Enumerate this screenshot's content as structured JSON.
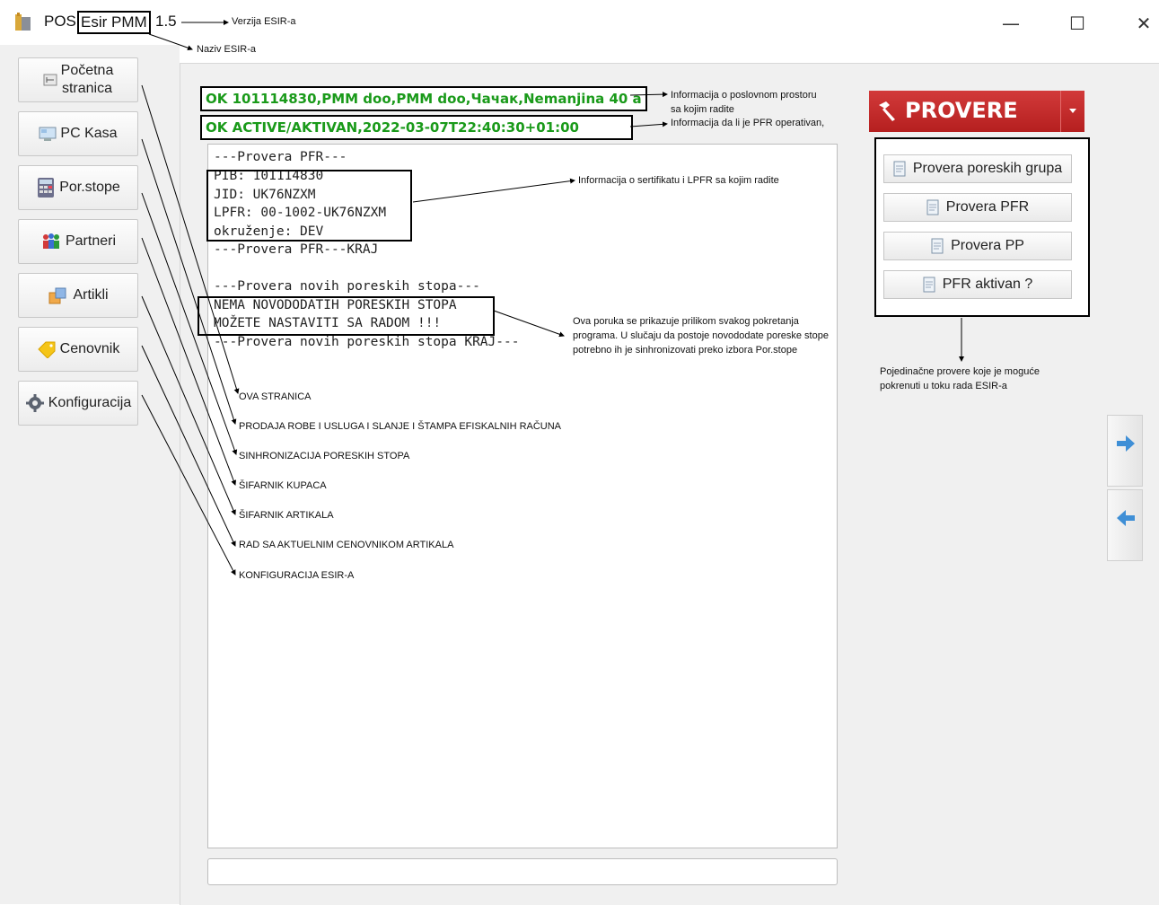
{
  "window": {
    "title_prefix": "POS",
    "app_name": "Esir PMM",
    "version": "1.5",
    "minimize": "—",
    "maximize": "☐",
    "close": "✕"
  },
  "nav": {
    "home_line1": "Početna",
    "home_line2": "stranica",
    "pc_kasa": "PC Kasa",
    "por_stope": "Por.stope",
    "partneri": "Partneri",
    "artikli": "Artikli",
    "cenovnik": "Cenovnik",
    "konfiguracija": "Konfiguracija"
  },
  "status": {
    "business_info": "OK 101114830,PMM doo,PMM doo,Чачак,Nemanjina 40 a",
    "pfr_status": "OK ACTIVE/AKTIVAN,2022-03-07T22:40:30+01:00"
  },
  "log": {
    "lines": [
      "---Provera PFR---",
      "PIB: 101114830",
      "JID: UK76NZXM",
      "LPFR: 00-1002-UK76NZXM",
      "okruženje: DEV",
      "---Provera PFR---KRAJ",
      "",
      "---Provera novih poreskih stopa---",
      "NEMA NOVODODATIH PORESKIH STOPA",
      "MOŽETE NASTAVITI SA RADOM !!!",
      "---Provera novih poreskih stopa KRAJ---"
    ]
  },
  "provere": {
    "title": "PROVERE",
    "buttons": [
      "Provera poreskih grupa",
      "Provera PFR",
      "Provera PP",
      "PFR aktivan ?"
    ]
  },
  "annotations": {
    "verzija": "Verzija ESIR-a",
    "naziv": "Naziv ESIR-a",
    "poslovni_prostor_1": "Informacija o poslovnom prostoru",
    "poslovni_prostor_2": "sa kojim radite",
    "pfr_operativan": "Informacija da li je PFR operativan,",
    "sertifikat": "Informacija o sertifikatu i LPFR sa kojim radite",
    "poruka": "Ova poruka se prikazuje prilikom svakog pokretanja programa. U slučaju da postoje novododate poreske stope potrebno ih je sinhronizovati preko izbora Por.stope",
    "pojedinacne": "Pojedinačne provere koje je moguće pokrenuti u toku rada ESIR-a",
    "captions": [
      "OVA STRANICA",
      "PRODAJA ROBE I USLUGA I SLANJE I ŠTAMPA EFISKALNIH RAČUNA",
      "SINHRONIZACIJA PORESKIH STOPA",
      "ŠIFARNIK KUPACA",
      "ŠIFARNIK ARTIKALA",
      "RAD SA AKTUELNIM CENOVNIKOM ARTIKALA",
      "KONFIGURACIJA ESIR-A"
    ]
  }
}
